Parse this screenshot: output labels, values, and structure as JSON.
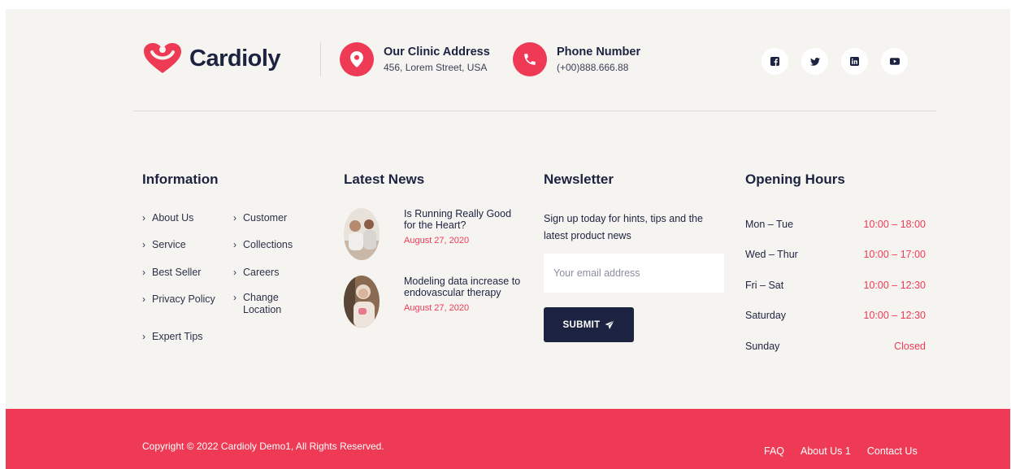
{
  "brand": {
    "name": "Cardioly"
  },
  "contact": {
    "address": {
      "title": "Our Clinic Address",
      "value": "456, Lorem Street, USA",
      "icon": "map-pin-icon"
    },
    "phone": {
      "title": "Phone Number",
      "value": "(+00)888.666.88",
      "icon": "phone-icon"
    }
  },
  "social": [
    "facebook-icon",
    "twitter-icon",
    "linkedin-icon",
    "youtube-icon"
  ],
  "information": {
    "title": "Information",
    "links_left": [
      "About Us",
      "Service",
      "Best Seller",
      "Privacy Policy",
      "Expert Tips"
    ],
    "links_right": [
      "Customer",
      "Collections",
      "Careers",
      "Change\nLocation"
    ]
  },
  "news": {
    "title": "Latest News",
    "items": [
      {
        "title": "Is Running Really Good for the Heart?",
        "date": "August 27, 2020"
      },
      {
        "title": "Modeling data increase to endovascular therapy",
        "date": "August 27, 2020"
      }
    ]
  },
  "newsletter": {
    "title": "Newsletter",
    "text": "Sign up today for hints, tips and the latest product news",
    "placeholder": "Your email address",
    "submit": "SUBMIT"
  },
  "hours": {
    "title": "Opening Hours",
    "rows": [
      {
        "day": "Mon – Tue",
        "time": "10:00 – 18:00"
      },
      {
        "day": "Wed – Thur",
        "time": "10:00 – 17:00"
      },
      {
        "day": "Fri – Sat",
        "time": "10:00 – 12:30"
      },
      {
        "day": "Saturday",
        "time": "10:00 – 12:30"
      },
      {
        "day": "Sunday",
        "time": "Closed"
      }
    ]
  },
  "bottom": {
    "copyright": "Copyright © 2022 Cardioly Demo1, All Rights Reserved.",
    "links": [
      "FAQ",
      "About Us 1",
      "Contact Us"
    ]
  },
  "colors": {
    "accent": "#ef3a55",
    "navy": "#1c2340",
    "footer_bg": "#f6f4f1"
  }
}
